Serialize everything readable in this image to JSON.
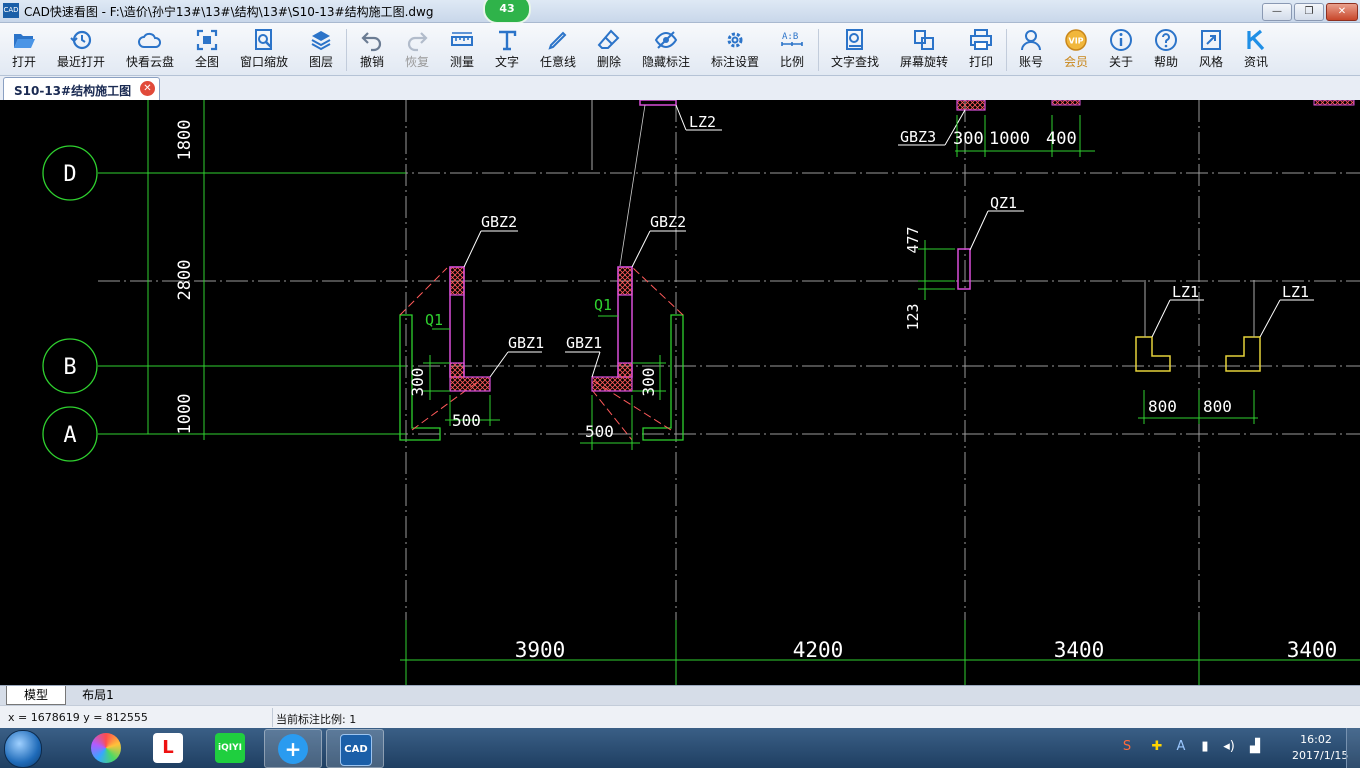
{
  "window": {
    "title": "CAD快速看图 - F:\\造价\\孙宁13#\\13#\\结构\\13#\\S10-13#结构施工图.dwg",
    "badge": "43",
    "app_icon_text": "CAD",
    "minimize": "—",
    "maximize": "❐",
    "close": "✕"
  },
  "toolbar": {
    "open": "打开",
    "recent": "最近打开",
    "cloud": "快看云盘",
    "full": "全图",
    "window_zoom": "窗口缩放",
    "layers": "图层",
    "undo": "撤销",
    "redo": "恢复",
    "measure": "测量",
    "text": "文字",
    "freeline": "任意线",
    "delete": "删除",
    "hide_dim": "隐藏标注",
    "dim_settings": "标注设置",
    "scale": "比例",
    "text_search": "文字查找",
    "rotate": "屏幕旋转",
    "print": "打印",
    "account": "账号",
    "vip": "会员",
    "about": "关于",
    "help": "帮助",
    "style": "风格",
    "news": "资讯"
  },
  "tab": {
    "name": "S10-13#结构施工图",
    "close": "✕"
  },
  "drawing": {
    "grid_axes": [
      "D",
      "B",
      "A"
    ],
    "vertical_dims": [
      "1800",
      "2800",
      "1000"
    ],
    "bottom_dims": [
      "3900",
      "4200",
      "3400",
      "3400"
    ],
    "labels": {
      "lz2": "LZ2",
      "gbz3": "GBZ3",
      "dim_300_top": "300",
      "dim_1000_top": "1000",
      "dim_400_top": "400",
      "qz1": "QZ1",
      "dim_477": "477",
      "dim_123": "123",
      "gbz2_left": "GBZ2",
      "gbz2_right": "GBZ2",
      "q1_left": "Q1",
      "q1_right": "Q1",
      "gbz1_left": "GBZ1",
      "gbz1_right": "GBZ1",
      "dim_300_left": "300",
      "dim_300_right": "300",
      "dim_500_left": "500",
      "dim_500_right": "500",
      "lz1_left": "LZ1",
      "lz1_right": "LZ1",
      "dim_800_left": "800",
      "dim_800_right": "800"
    }
  },
  "layout_tabs": {
    "model": "模型",
    "layout1": "布局1"
  },
  "status": {
    "coords": "x = 1678619  y = 812555",
    "scale": "当前标注比例: 1"
  },
  "taskbar": {
    "app_cad": "CAD",
    "app_iqiyi": "iQIYI",
    "time": "16:02",
    "date": "2017/1/15"
  }
}
